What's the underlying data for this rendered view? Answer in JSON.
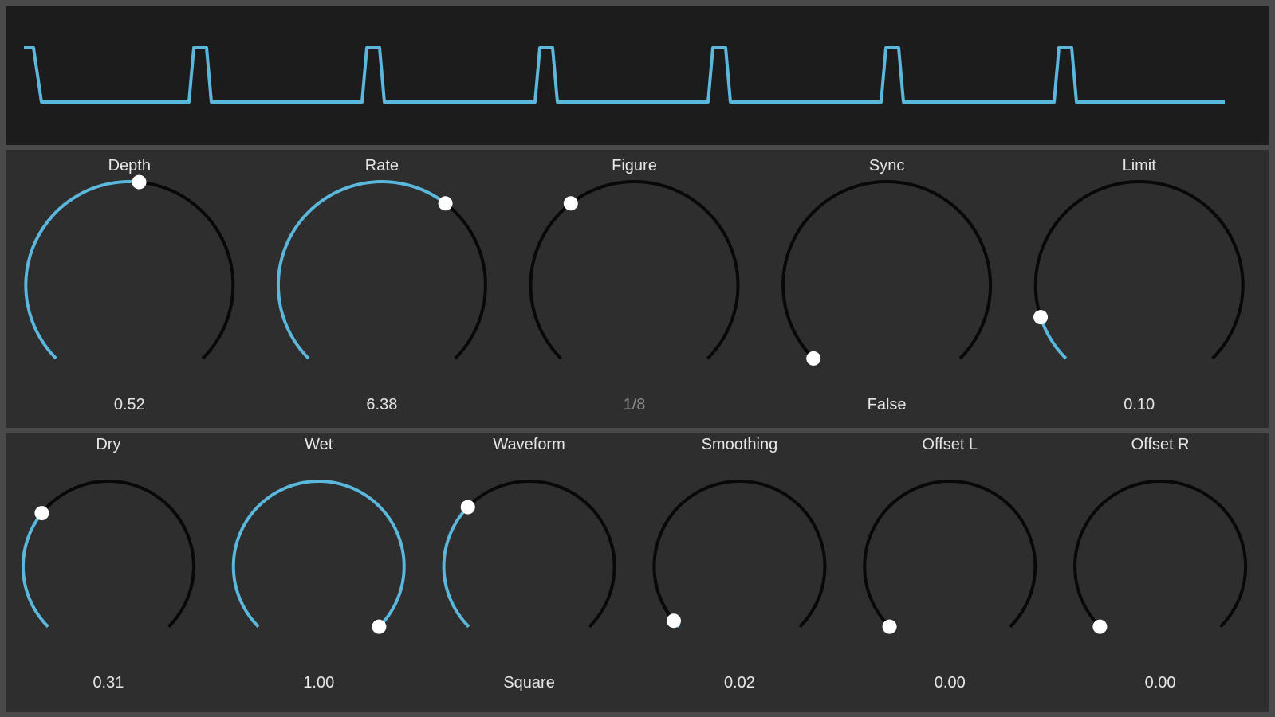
{
  "colors": {
    "accent": "#5bb8dc",
    "track": "#080808",
    "indicator": "#ffffff",
    "panel": "#2e2e2e",
    "scope_bg": "#1c1c1c"
  },
  "scope": {
    "waveform": "square",
    "cycles": 7,
    "line_color": "#5bb8dc"
  },
  "rows": [
    {
      "knobs": [
        {
          "id": "depth",
          "label": "Depth",
          "value_text": "0.52",
          "fraction": 0.52,
          "dim": false
        },
        {
          "id": "rate",
          "label": "Rate",
          "value_text": "6.38",
          "fraction": 0.64,
          "dim": false
        },
        {
          "id": "figure",
          "label": "Figure",
          "value_text": "1/8",
          "fraction": 0.36,
          "dim": true,
          "no_fill": true
        },
        {
          "id": "sync",
          "label": "Sync",
          "value_text": "False",
          "fraction": 0.0,
          "dim": false
        },
        {
          "id": "limit",
          "label": "Limit",
          "value_text": "0.10",
          "fraction": 0.1,
          "dim": false
        }
      ]
    },
    {
      "knobs": [
        {
          "id": "dry",
          "label": "Dry",
          "value_text": "0.31",
          "fraction": 0.31,
          "dim": false
        },
        {
          "id": "wet",
          "label": "Wet",
          "value_text": "1.00",
          "fraction": 1.0,
          "dim": false
        },
        {
          "id": "waveform",
          "label": "Waveform",
          "value_text": "Square",
          "fraction": 0.33,
          "dim": false
        },
        {
          "id": "smoothing",
          "label": "Smoothing",
          "value_text": "0.02",
          "fraction": 0.02,
          "dim": false
        },
        {
          "id": "offset-l",
          "label": "Offset L",
          "value_text": "0.00",
          "fraction": 0.0,
          "dim": false
        },
        {
          "id": "offset-r",
          "label": "Offset R",
          "value_text": "0.00",
          "fraction": 0.0,
          "dim": false
        }
      ]
    }
  ]
}
